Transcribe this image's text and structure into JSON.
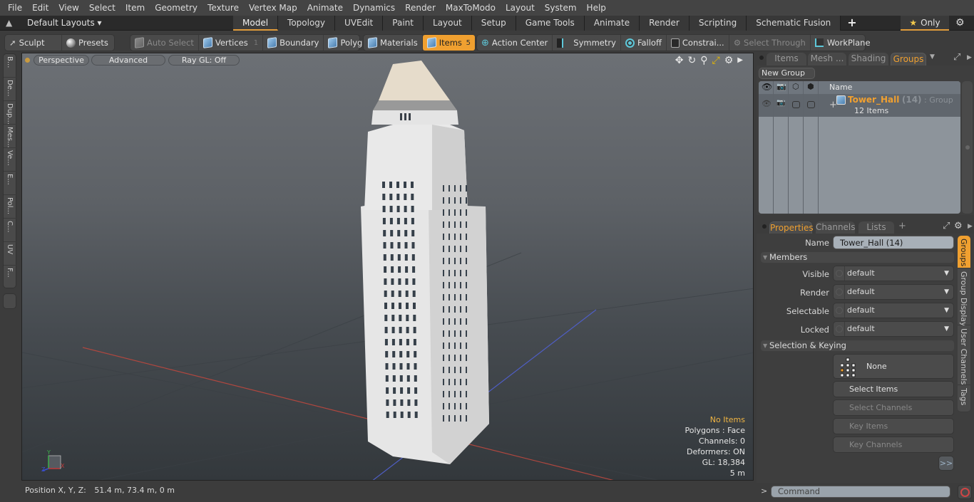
{
  "menu": [
    "File",
    "Edit",
    "View",
    "Select",
    "Item",
    "Geometry",
    "Texture",
    "Vertex Map",
    "Animate",
    "Dynamics",
    "Render",
    "MaxToModo",
    "Layout",
    "System",
    "Help"
  ],
  "layout_bar": {
    "layouts_label": "Default Layouts ▾",
    "tabs": [
      "Model",
      "Topology",
      "UVEdit",
      "Paint",
      "Layout",
      "Setup",
      "Game Tools",
      "Animate",
      "Render",
      "Scripting",
      "Schematic Fusion"
    ],
    "active_tab": "Model",
    "add_tab": "+",
    "only_label": "Only",
    "only_icon": "★"
  },
  "toolbar": {
    "sculpt": "Sculpt",
    "presets": "Presets",
    "auto_select": "Auto Select",
    "vertices": "Vertices",
    "vertices_count": "1",
    "boundary": "Boundary",
    "polygons": "Polygons",
    "materials": "Materials",
    "items": "Items",
    "items_count": "5",
    "action_center": "Action Center",
    "symmetry": "Symmetry",
    "falloff": "Falloff",
    "constraints": "Constrai...",
    "select_through": "Select Through",
    "workplane": "WorkPlane"
  },
  "left_tabs": [
    "B...",
    "De...",
    "Dup...",
    "Mes...",
    "Ve...",
    "E...",
    "Pol...",
    "C...",
    "UV",
    "F..."
  ],
  "viewport": {
    "view_mode": "Perspective",
    "shading": "Advanced",
    "raygl": "Ray GL: Off",
    "stats": {
      "selection": "No Items",
      "polygons": "Polygons : Face",
      "channels": "Channels: 0",
      "deformers": "Deformers: ON",
      "gl": "GL: 18,384",
      "scale": "5 m"
    },
    "axis_labels": {
      "x": "X",
      "y": "Y",
      "z": "Z"
    }
  },
  "status": {
    "position_label": "Position X, Y, Z:",
    "position_value": "51.4 m, 73.4 m, 0 m"
  },
  "groups_panel": {
    "tabs": [
      "Items",
      "Mesh ...",
      "Shading",
      "Groups"
    ],
    "active_tab": "Groups",
    "new_group": "New Group",
    "column_name": "Name",
    "rows": [
      {
        "name": "Tower_Hall",
        "count": "(14)",
        "type": ": Group",
        "sub": "12 Items",
        "expander": "+"
      }
    ]
  },
  "properties": {
    "tabs": [
      "Properties",
      "Channels",
      "Lists"
    ],
    "active_tab": "Properties",
    "add_tab": "+",
    "name_label": "Name",
    "name_value": "Tower_Hall (14)",
    "members_section": "Members",
    "fields": [
      {
        "label": "Visible",
        "value": "default"
      },
      {
        "label": "Render",
        "value": "default"
      },
      {
        "label": "Selectable",
        "value": "default"
      },
      {
        "label": "Locked",
        "value": "default"
      }
    ],
    "selection_section": "Selection & Keying",
    "none_button": "None",
    "select_items": "Select Items",
    "select_channels": "Select Channels",
    "key_items": "Key Items",
    "key_channels": "Key Channels",
    "more": ">>",
    "side_tabs": [
      "Groups",
      "Group Display",
      "User Channels",
      "Tags"
    ]
  },
  "command": {
    "prompt": ">",
    "placeholder": "Command"
  },
  "colors": {
    "accent": "#f0a030",
    "group_name": "#f0a030",
    "warning_text": "#f0b442",
    "record": "#d04545"
  }
}
